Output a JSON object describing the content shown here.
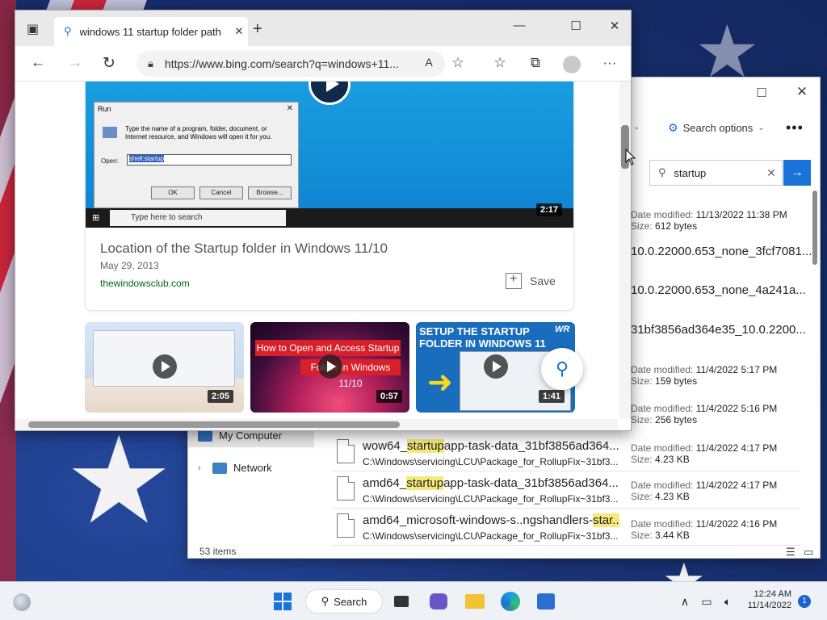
{
  "browser": {
    "tab_title": "windows 11 startup folder path",
    "url": "https://www.bing.com/search?q=windows+11...",
    "main_result": {
      "title": "Location of the Startup folder in Windows 11/10",
      "date": "May 29, 2013",
      "source": "thewindowsclub.com",
      "save_label": "Save",
      "duration": "2:17",
      "run_dialog": {
        "title": "Run",
        "description": "Type the name of a program, folder, document, or Internet resource, and Windows will open it for you.",
        "open_label": "Open:",
        "open_value": "shell:startup",
        "ok": "OK",
        "cancel": "Cancel",
        "browse": "Browse...",
        "taskbar_search": "Type here to search"
      }
    },
    "thumbnails": [
      {
        "duration": "2:05"
      },
      {
        "duration": "0:57",
        "banner_top": "How to Open and Access Startup",
        "banner_bottom": "Folder in Windows 11/10"
      },
      {
        "duration": "1:41",
        "title": "SETUP THE STARTUP FOLDER IN WINDOWS 11",
        "logo": "WR"
      }
    ]
  },
  "explorer": {
    "search_options": "Search options",
    "search_value": "startup",
    "status": "53 items",
    "nav": [
      {
        "label": "My Computer"
      },
      {
        "label": "Network"
      }
    ],
    "fragments": [
      "10.0.22000.653_none_3fcf7081...",
      "10.0.22000.653_none_4a241a...",
      "31bf3856ad364e35_10.0.2200..."
    ],
    "meta": [
      {
        "modified_label": "Date modified:",
        "modified": "11/13/2022 11:38 PM",
        "size_label": "Size:",
        "size": "612 bytes"
      },
      {
        "modified_label": "Date modified:",
        "modified": "11/4/2022 5:17 PM",
        "size_label": "Size:",
        "size": "159 bytes"
      },
      {
        "modified_label": "Date modified:",
        "modified": "11/4/2022 5:16 PM",
        "size_label": "Size:",
        "size": "256 bytes"
      }
    ],
    "files": [
      {
        "name_pre": "wow64_",
        "name_hl": "startup",
        "name_post": "app-task-data_31bf3856ad364...",
        "path": "C:\\Windows\\servicing\\LCU\\Package_for_RollupFix~31bf3...",
        "modified_label": "Date modified:",
        "modified": "11/4/2022 4:17 PM",
        "size_label": "Size:",
        "size": "4.23 KB"
      },
      {
        "name_pre": "amd64_",
        "name_hl": "startup",
        "name_post": "app-task-data_31bf3856ad364...",
        "path": "C:\\Windows\\servicing\\LCU\\Package_for_RollupFix~31bf3...",
        "modified_label": "Date modified:",
        "modified": "11/4/2022 4:17 PM",
        "size_label": "Size:",
        "size": "4.23 KB"
      },
      {
        "name_pre": "amd64_microsoft-windows-s..ngshandlers-",
        "name_hl": "star...",
        "name_post": "",
        "path": "C:\\Windows\\servicing\\LCU\\Package_for_RollupFix~31bf3...",
        "modified_label": "Date modified:",
        "modified": "11/4/2022 4:16 PM",
        "size_label": "Size:",
        "size": "3.44 KB"
      }
    ]
  },
  "taskbar": {
    "search_label": "Search",
    "time": "12:24 AM",
    "date": "11/14/2022",
    "notification_count": "1"
  }
}
